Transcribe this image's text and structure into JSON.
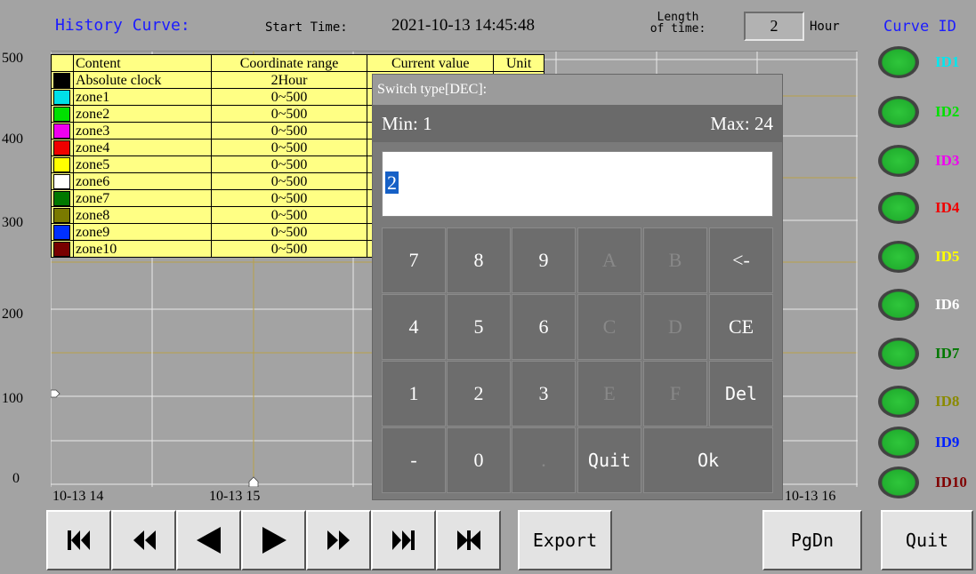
{
  "header": {
    "title": "History Curve:",
    "start_time_label": "Start Time:",
    "start_time_value": "2021-10-13 14:45:48",
    "length_label_line1": "Length",
    "length_label_line2": "of time:",
    "length_value": "2",
    "length_unit": "Hour",
    "curve_id_label": "Curve ID"
  },
  "chart": {
    "y_ticks": [
      "500",
      "400",
      "300",
      "200",
      "100",
      "0"
    ],
    "x_ticks": [
      "10-13 14",
      "10-13 15",
      "10-13 16"
    ],
    "grid_color": "#b8a04a"
  },
  "legend": {
    "headers": [
      "Content",
      "Coordinate range",
      "Current value",
      "Unit"
    ],
    "rows": [
      {
        "name": "Absolute clock",
        "range": "2Hour",
        "color": "#000000"
      },
      {
        "name": "zone1",
        "range": "0~500",
        "color": "#00e0e8"
      },
      {
        "name": "zone2",
        "range": "0~500",
        "color": "#00e000"
      },
      {
        "name": "zone3",
        "range": "0~500",
        "color": "#f000f0"
      },
      {
        "name": "zone4",
        "range": "0~500",
        "color": "#f00000"
      },
      {
        "name": "zone5",
        "range": "0~500",
        "color": "#ffff00"
      },
      {
        "name": "zone6",
        "range": "0~500",
        "color": "#ffffff"
      },
      {
        "name": "zone7",
        "range": "0~500",
        "color": "#007800"
      },
      {
        "name": "zone8",
        "range": "0~500",
        "color": "#7a7a00"
      },
      {
        "name": "zone9",
        "range": "0~500",
        "color": "#0030ff"
      },
      {
        "name": "zone10",
        "range": "0~500",
        "color": "#780000"
      }
    ]
  },
  "dialog": {
    "title": "Switch type[DEC]:",
    "min_label": "Min: 1",
    "max_label": "Max: 24",
    "input_value": "2",
    "keys": {
      "k7": "7",
      "k8": "8",
      "k9": "9",
      "kA": "A",
      "kB": "B",
      "kBack": "<-",
      "k4": "4",
      "k5": "5",
      "k6": "6",
      "kC": "C",
      "kD": "D",
      "kCE": "CE",
      "k1": "1",
      "k2": "2",
      "k3": "3",
      "kE": "E",
      "kF": "F",
      "kDel": "Del",
      "kMinus": "-",
      "k0": "0",
      "kDot": ".",
      "kQuit": "Quit",
      "kOk": "Ok"
    }
  },
  "curve_ids": [
    {
      "label": "ID1",
      "color": "#00e8f0"
    },
    {
      "label": "ID2",
      "color": "#00e000"
    },
    {
      "label": "ID3",
      "color": "#f000f0"
    },
    {
      "label": "ID4",
      "color": "#f00000"
    },
    {
      "label": "ID5",
      "color": "#ffff00"
    },
    {
      "label": "ID6",
      "color": "#ffffff"
    },
    {
      "label": "ID7",
      "color": "#007800"
    },
    {
      "label": "ID8",
      "color": "#8a8a00"
    },
    {
      "label": "ID9",
      "color": "#0020ff"
    },
    {
      "label": "ID10",
      "color": "#800000"
    }
  ],
  "toolbar": {
    "nav_icons": [
      "skip-to-start-icon",
      "fast-rewind-icon",
      "step-back-icon",
      "step-forward-icon",
      "fast-forward-icon",
      "skip-to-end-icon",
      "jump-to-now-icon"
    ],
    "export_label": "Export",
    "pgdn_label": "PgDn",
    "quit_label": "Quit"
  }
}
